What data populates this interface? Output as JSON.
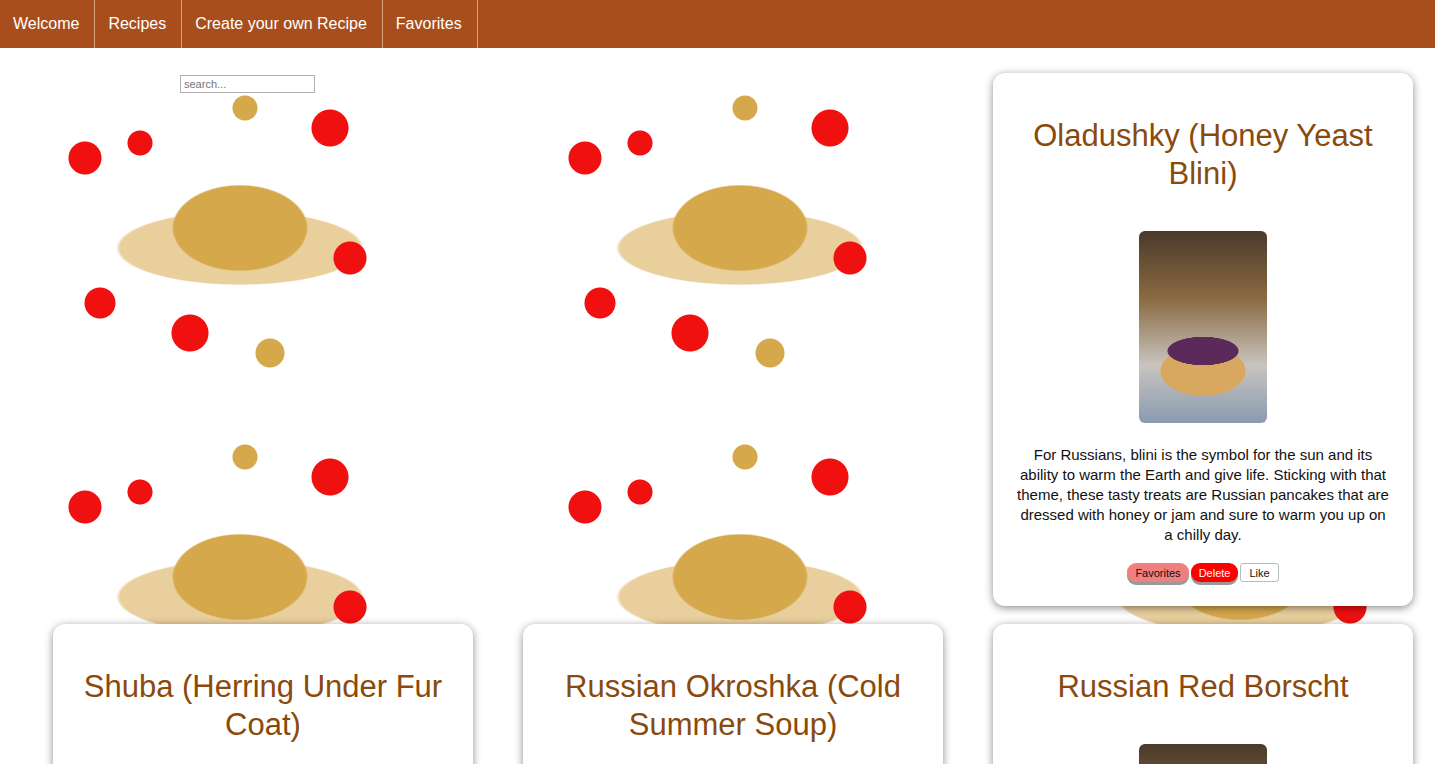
{
  "nav": [
    {
      "label": "Welcome"
    },
    {
      "label": "Recipes"
    },
    {
      "label": "Create your own Recipe"
    },
    {
      "label": "Favorites"
    }
  ],
  "search": {
    "placeholder": "search..."
  },
  "cards": [
    {
      "title": "Oladushky (Honey Yeast Blini)",
      "description": "For Russians, blini is the symbol for the sun and its ability to warm the Earth and give life. Sticking with that theme, these tasty treats are Russian pancakes that are dressed with honey or jam and sure to warm you up on a chilly day.",
      "buttons": [
        {
          "label": "Favorites",
          "kind": "favorite"
        },
        {
          "label": "Delete",
          "kind": "delete"
        },
        {
          "label": "Like",
          "kind": "like"
        }
      ]
    },
    {
      "title": "Shuba (Herring Under Fur Coat)"
    },
    {
      "title": "Russian Okroshka (Cold Summer Soup)"
    },
    {
      "title": "Russian Red Borscht"
    }
  ]
}
